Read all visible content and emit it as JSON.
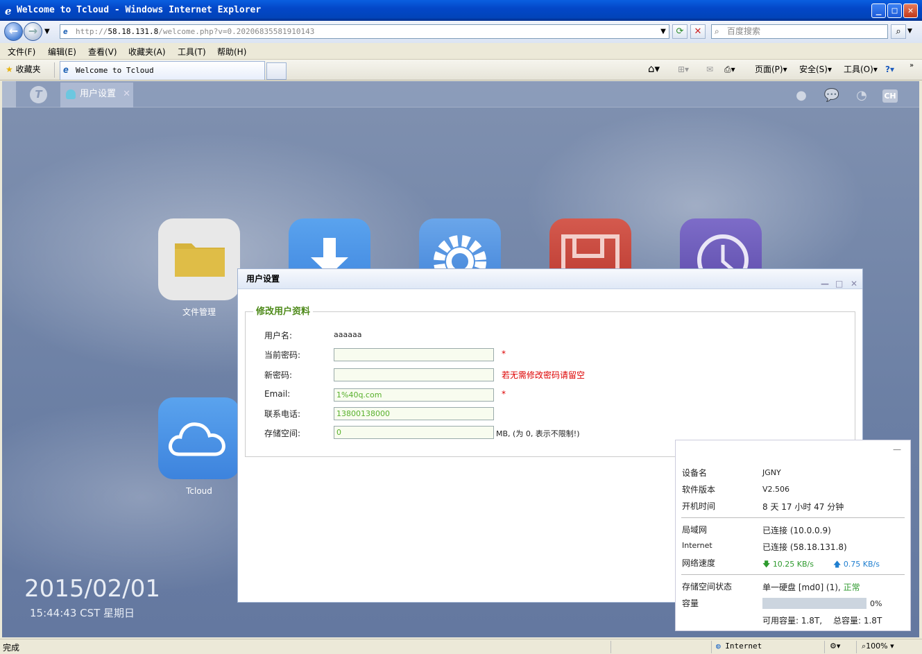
{
  "window": {
    "title": "Welcome to Tcloud - Windows Internet Explorer"
  },
  "nav": {
    "url_scheme": "http://",
    "url_host": "58.18.131.8",
    "url_path": "/welcome.php?v=0.20206835581910143",
    "search_placeholder": "百度搜索"
  },
  "menu": [
    "文件(F)",
    "编辑(E)",
    "查看(V)",
    "收藏夹(A)",
    "工具(T)",
    "帮助(H)"
  ],
  "favbar": {
    "favorites_label": "收藏夹",
    "tab_title": "Welcome to Tcloud",
    "page_label": "页面(P)",
    "safety_label": "安全(S)",
    "tools_label": "工具(O)"
  },
  "app": {
    "tab_label": "用户设置",
    "lang": "CH",
    "icons": [
      {
        "label": "文件管理",
        "icon": "folder-icon",
        "color": "#e6e6e6"
      },
      {
        "label": "",
        "icon": "download-icon",
        "color": "#3d8be0"
      },
      {
        "label": "",
        "icon": "gear-icon",
        "color": "#4a8ed8"
      },
      {
        "label": "",
        "icon": "floppy-icon",
        "color": "#c9443a"
      },
      {
        "label": "",
        "icon": "clock-icon",
        "color": "#6a5ab8"
      },
      {
        "label": "Tcloud",
        "icon": "cloud-icon",
        "color": "#3d8be0"
      }
    ],
    "date": "2015/02/01",
    "time": "15:44:43 CST 星期日"
  },
  "dialog": {
    "title": "用户设置",
    "legend": "修改用户资料",
    "username_label": "用户名:",
    "username_value": "aaaaaa",
    "current_pw_label": "当前密码:",
    "current_pw_value": "",
    "new_pw_label": "新密码:",
    "new_pw_value": "",
    "new_pw_hint": "若无需修改密码请留空",
    "email_label": "Email:",
    "email_value": "1%40q.com",
    "phone_label": "联系电话:",
    "phone_value": "13800138000",
    "storage_label": "存储空间:",
    "storage_value": "0",
    "storage_hint": "MB, (为 0, 表示不限制!)",
    "required_mark": "*"
  },
  "info": {
    "device_label": "设备名",
    "device_value": "JGNY",
    "version_label": "软件版本",
    "version_value": "V2.506",
    "uptime_label": "开机时间",
    "uptime_value": "8 天 17 小时 47 分钟",
    "lan_label": "局域网",
    "lan_value": "已连接 (10.0.0.9)",
    "internet_label": "Internet",
    "internet_value": "已连接 (58.18.131.8)",
    "speed_label": "网络速度",
    "speed_down": "10.25 KB/s",
    "speed_up": "0.75 KB/s",
    "storage_status_label": "存储空间状态",
    "storage_status_value": "单一硬盘 [md0] (1),",
    "storage_status_ok": "正常",
    "capacity_label": "容量",
    "capacity_percent": "0%",
    "capacity_fraction": 0,
    "available_label": "可用容量: 1.8T,",
    "total_label": "总容量: 1.8T"
  },
  "statusbar": {
    "text": "完成",
    "zone": "Internet",
    "zoom": "100%"
  },
  "colors": {
    "accent_green": "#4e8a1a",
    "required_red": "#dd0000",
    "speed_down": "#2e9a2e",
    "speed_up": "#1f7fd0"
  }
}
